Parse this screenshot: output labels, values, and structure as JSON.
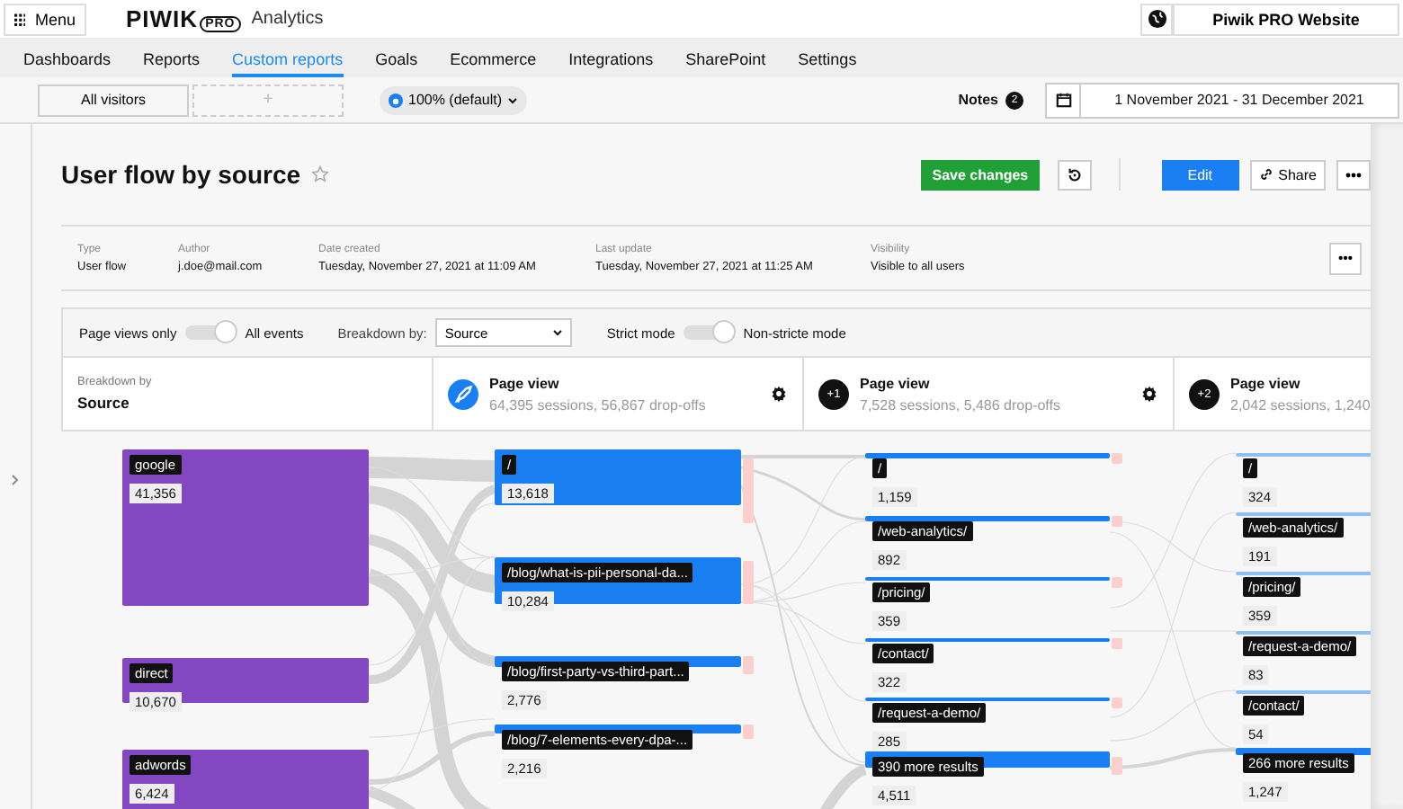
{
  "topbar": {
    "menu_label": "Menu",
    "logo": "PIWIK",
    "logo_badge": "PRO",
    "product": "Analytics",
    "site": "Piwik PRO Website"
  },
  "tabs": [
    {
      "label": "Dashboards",
      "selected": false
    },
    {
      "label": "Reports",
      "selected": false
    },
    {
      "label": "Custom reports",
      "selected": true
    },
    {
      "label": "Goals",
      "selected": false
    },
    {
      "label": "Ecommerce",
      "selected": false
    },
    {
      "label": "Integrations",
      "selected": false
    },
    {
      "label": "SharePoint",
      "selected": false
    },
    {
      "label": "Settings",
      "selected": false
    }
  ],
  "toolbar": {
    "segment": "All visitors",
    "add_segment": "+",
    "sampling": "100% (default)",
    "notes": "Notes",
    "notes_count": "2",
    "date_range": "1 November 2021 - 31 December 2021"
  },
  "report": {
    "title": "User flow by source",
    "starred": false,
    "save_label": "Save changes",
    "edit_label": "Edit",
    "share_label": "Share"
  },
  "meta": [
    {
      "label": "Type",
      "value": "User flow"
    },
    {
      "label": "Author",
      "value": "j.doe@mail.com"
    },
    {
      "label": "Date created",
      "value": "Tuesday, November 27, 2021 at 11:09 AM"
    },
    {
      "label": "Last update",
      "value": "Tuesday, November 27, 2021 at 11:25 AM"
    },
    {
      "label": "Visibility",
      "value": "Visible to all users"
    }
  ],
  "filters": {
    "toggle_1": {
      "left": "Page views only",
      "right": "All events",
      "on": true
    },
    "breakdown_label": "Breakdown by:",
    "breakdown_value": "Source",
    "toggle_2": {
      "left": "Strict mode",
      "right": "Non-stricte mode",
      "on": true
    }
  },
  "columns": [
    {
      "kind": "breakdown",
      "title": "Breakdown by",
      "subtitle": "Source",
      "nodes": [
        {
          "name": "google",
          "value": "41,356"
        },
        {
          "name": "direct",
          "value": "10,670"
        },
        {
          "name": "adwords",
          "value": "6,424"
        }
      ]
    },
    {
      "kind": "start",
      "title": "Page view",
      "subtitle": "64,395 sessions, 56,867 drop-offs",
      "nodes": [
        {
          "name": "/",
          "value": "13,618"
        },
        {
          "name": "/blog/what-is-pii-personal-da...",
          "value": "10,284"
        },
        {
          "name": "/blog/first-party-vs-third-part...",
          "value": "2,776"
        },
        {
          "name": "/blog/7-elements-every-dpa-...",
          "value": "2,216"
        }
      ]
    },
    {
      "kind": "step",
      "badge": "+1",
      "title": "Page view",
      "subtitle": "7,528 sessions, 5,486 drop-offs",
      "nodes": [
        {
          "name": "/",
          "value": "1,159"
        },
        {
          "name": "/web-analytics/",
          "value": "892"
        },
        {
          "name": "/pricing/",
          "value": "359"
        },
        {
          "name": "/contact/",
          "value": "322"
        },
        {
          "name": "/request-a-demo/",
          "value": "285"
        },
        {
          "name": "390 more results",
          "value": "4,511"
        }
      ]
    },
    {
      "kind": "step",
      "badge": "+2",
      "title": "Page view",
      "subtitle": "2,042 sessions, 1,240",
      "nodes": [
        {
          "name": "/",
          "value": "324"
        },
        {
          "name": "/web-analytics/",
          "value": "191"
        },
        {
          "name": "/pricing/",
          "value": "359"
        },
        {
          "name": "/request-a-demo/",
          "value": "83"
        },
        {
          "name": "/contact/",
          "value": "54"
        },
        {
          "name": "266 more results",
          "value": "1,247"
        }
      ]
    }
  ]
}
